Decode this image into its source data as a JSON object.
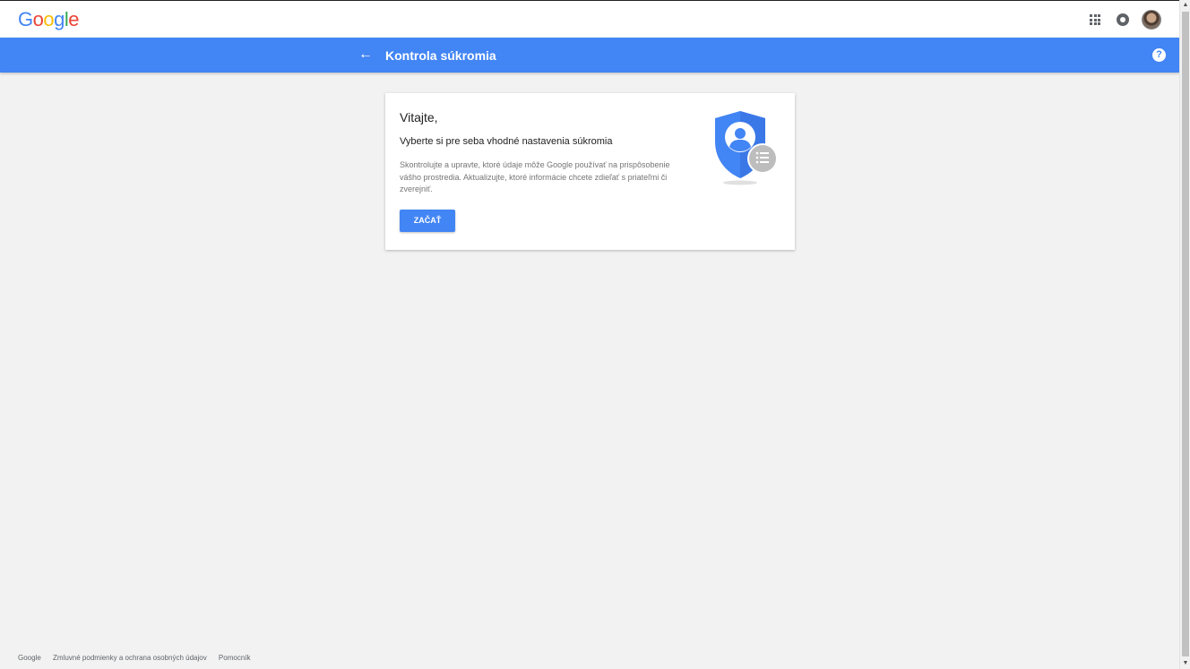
{
  "brand": {
    "logo_letters": [
      "G",
      "o",
      "o",
      "g",
      "l",
      "e"
    ],
    "logo_colors": [
      "#4285f4",
      "#ea4335",
      "#fbbc05",
      "#4285f4",
      "#34a853",
      "#ea4335"
    ]
  },
  "topbar": {
    "apps_icon": "apps-grid-icon",
    "notifications_icon": "notifications-icon",
    "avatar": "user-avatar"
  },
  "header": {
    "back_icon": "←",
    "title": "Kontrola súkromia",
    "help_icon": "?",
    "color": "#4285f4"
  },
  "card": {
    "title": "Vitajte,",
    "subtitle": "Vyberte si pre seba vhodné nastavenia súkromia",
    "description": "Skontrolujte a upravte, ktoré údaje môže Google používať na prispôsobenie vášho prostredia. Aktualizujte, ktoré informácie chcete zdieľať s priateľmi či zverejniť.",
    "button_label": "ZAČAŤ",
    "illustration": "privacy-shield-icon"
  },
  "footer": {
    "links": [
      "Google",
      "Zmluvné podmienky a ochrana osobných údajov",
      "Pomocník"
    ]
  },
  "scrollbar": {
    "up": "▲",
    "down": "▼"
  }
}
